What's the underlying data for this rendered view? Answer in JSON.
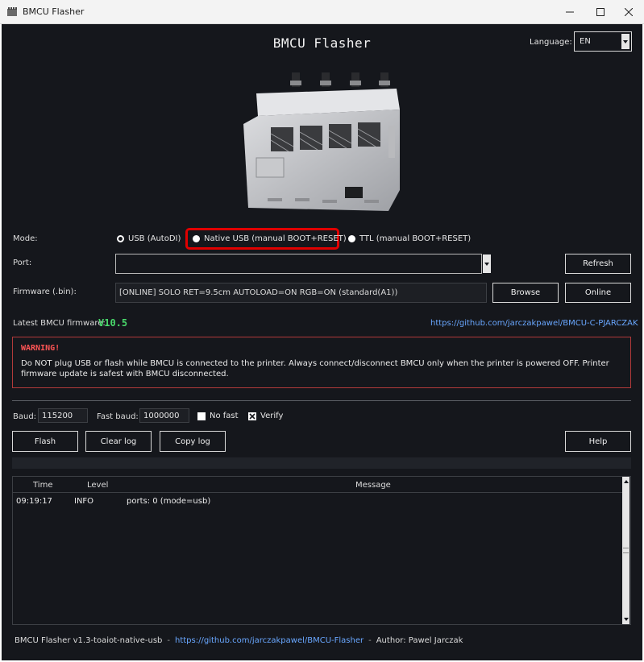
{
  "window": {
    "title": "BMCU Flasher"
  },
  "header": {
    "title": "BMCU Flasher",
    "language_label": "Language:",
    "language_value": "EN"
  },
  "mode": {
    "label": "Mode:",
    "options": [
      "USB (AutoDI)",
      "Native USB (manual BOOT+RESET)",
      "TTL (manual BOOT+RESET)"
    ],
    "selected": "USB (AutoDI)"
  },
  "port": {
    "label": "Port:",
    "value": "",
    "refresh_label": "Refresh"
  },
  "firmware": {
    "label": "Firmware (.bin):",
    "value": "[ONLINE] SOLO RET=9.5cm AUTOLOAD=ON RGB=ON (standard(A1))",
    "browse_label": "Browse",
    "online_label": "Online"
  },
  "latest": {
    "label": "Latest BMCU firmware:",
    "version": "V10.5",
    "link": "https://github.com/jarczakpawel/BMCU-C-PJARCZAK"
  },
  "warning": {
    "title": "WARNING!",
    "text": "Do NOT plug USB or flash while BMCU is connected to the printer. Always connect/disconnect BMCU only when the printer is powered OFF. Printer firmware update is safest with BMCU disconnected."
  },
  "settings": {
    "baud_label": "Baud:",
    "baud_value": "115200",
    "fast_baud_label": "Fast baud:",
    "fast_baud_value": "1000000",
    "no_fast_label": "No fast",
    "no_fast_checked": false,
    "verify_label": "Verify",
    "verify_checked": true
  },
  "actions": {
    "flash": "Flash",
    "clear_log": "Clear log",
    "copy_log": "Copy log",
    "help": "Help"
  },
  "log": {
    "columns": [
      "Time",
      "Level",
      "Message"
    ],
    "rows": [
      {
        "time": "09:19:17",
        "level": "INFO",
        "message": "ports: 0 (mode=usb)"
      }
    ]
  },
  "footer": {
    "version": "BMCU Flasher v1.3-toaiot-native-usb",
    "link": "https://github.com/jarczakpawel/BMCU-Flasher",
    "author": "Author: Pawel Jarczak"
  },
  "colors": {
    "background": "#15171c",
    "accent_link": "#69a7ff",
    "version_green": "#49d86b",
    "warning_red": "#ff5555",
    "highlight_red": "#e00000"
  }
}
